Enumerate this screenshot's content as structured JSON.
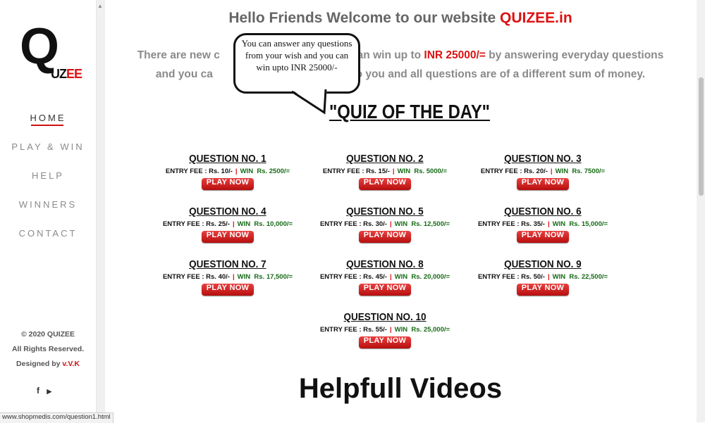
{
  "logo": {
    "q": "Q",
    "u": "U",
    "z": "Z",
    "ee": "EE"
  },
  "nav": [
    {
      "label": "HOME",
      "active": true
    },
    {
      "label": "PLAY & WIN"
    },
    {
      "label": "HELP"
    },
    {
      "label": "WINNERS"
    },
    {
      "label": "CONTACT"
    }
  ],
  "footer": {
    "copyright": "© 2020 QUIZEE",
    "rights": "All Rights Reserved.",
    "designed_prefix": "Designed by ",
    "designed_by": "v.V.K",
    "social_icons": [
      "facebook-icon",
      "youtube-icon"
    ]
  },
  "welcome": {
    "text": "Hello Friends Welcome to our website ",
    "brand": "QUIZEE.in"
  },
  "description": {
    "line1_a": "There are new c",
    "line1_b": " you can win up to ",
    "line1_money": "INR 25000/=",
    "line1_c": " by answering everyday questions",
    "line2_a": "and you ca",
    "line2_b": "ing to you and all questions are of a different sum of money."
  },
  "bubble": {
    "text": "You can answer any questions from your wish and you can win upto INR 25000/-"
  },
  "quiz_title": "\"QUIZ OF THE DAY\"",
  "questions": [
    {
      "title": "QUESTION NO. 1",
      "fee": "ENTRY FEE : Rs. 10/-",
      "win_label": "WIN",
      "win": "Rs.   2500/="
    },
    {
      "title": "QUESTION NO. 2",
      "fee": "ENTRY FEE : Rs. 15/-",
      "win_label": "WIN",
      "win": "Rs.   5000/="
    },
    {
      "title": "QUESTION NO. 3",
      "fee": "ENTRY FEE : Rs. 20/-",
      "win_label": "WIN",
      "win": "Rs.   7500/="
    },
    {
      "title": "QUESTION NO. 4",
      "fee": "ENTRY FEE : Rs. 25/-",
      "win_label": "WIN",
      "win": "Rs. 10,000/="
    },
    {
      "title": "QUESTION NO. 5",
      "fee": "ENTRY FEE : Rs. 30/-",
      "win_label": "WIN",
      "win": "Rs. 12,500/="
    },
    {
      "title": "QUESTION NO. 6",
      "fee": "ENTRY FEE : Rs. 35/-",
      "win_label": "WIN",
      "win": "Rs. 15,000/="
    },
    {
      "title": "QUESTION NO. 7",
      "fee": "ENTRY FEE : Rs. 40/-",
      "win_label": "WIN",
      "win": "Rs. 17,500/="
    },
    {
      "title": "QUESTION NO. 8",
      "fee": "ENTRY FEE : Rs. 45/-",
      "win_label": "WIN",
      "win": "Rs. 20,000/="
    },
    {
      "title": "QUESTION NO. 9",
      "fee": "ENTRY FEE : Rs. 50/-",
      "win_label": "WIN",
      "win": "Rs. 22,500/="
    },
    {
      "title": "QUESTION NO. 10",
      "fee": "ENTRY FEE : Rs. 55/-",
      "win_label": "WIN",
      "win": "Rs. 25,000/="
    }
  ],
  "separator": "|",
  "play_label": "PLAY NOW",
  "videos_heading": "Helpfull Videos",
  "status_url": "www.shopmedis.com/question1.html",
  "colors": {
    "accent_red": "#d11",
    "win_green": "#166a16"
  }
}
